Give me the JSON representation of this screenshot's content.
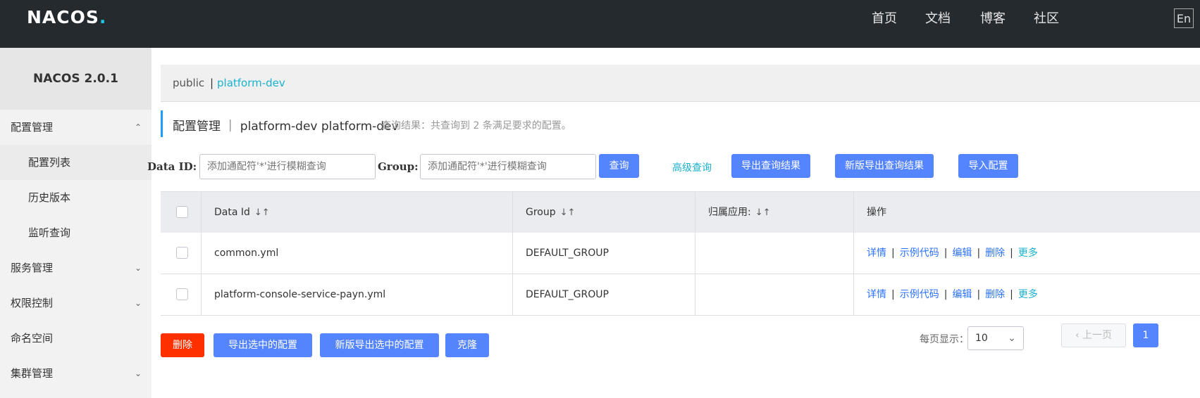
{
  "header": {
    "logo": "NACOS",
    "logo_dot": ".",
    "nav": [
      "首页",
      "文档",
      "博客",
      "社区"
    ],
    "lang": "En"
  },
  "sidebar": {
    "version": "NACOS 2.0.1",
    "items": [
      {
        "label": "配置管理",
        "expanded": true
      },
      {
        "label": "配置列表"
      },
      {
        "label": "历史版本"
      },
      {
        "label": "监听查询"
      },
      {
        "label": "服务管理"
      },
      {
        "label": "权限控制"
      },
      {
        "label": "命名空间"
      },
      {
        "label": "集群管理"
      }
    ]
  },
  "namespace_bar": {
    "items": [
      "public",
      "|",
      "platform-dev"
    ]
  },
  "title": {
    "text": "配置管理 ｜ platform-dev  platform-dev",
    "note": "查询结果：共查询到 2 条满足要求的配置。"
  },
  "search": {
    "data_id_label": "Data ID:",
    "data_id_placeholder": "添加通配符'*'进行模糊查询",
    "group_label": "Group:",
    "group_placeholder": "添加通配符'*'进行模糊查询",
    "query_button": "查询",
    "advanced_query": "高级查询",
    "export_button": "导出查询结果",
    "new_export_button": "新版导出查询结果",
    "import_button": "导入配置"
  },
  "table": {
    "headers": [
      "Data Id",
      "Group",
      "归属应用:",
      "操作"
    ],
    "rows": [
      {
        "data_id": "common.yml",
        "group": "DEFAULT_GROUP",
        "app": ""
      },
      {
        "data_id": "platform-console-service-payn.yml",
        "group": "DEFAULT_GROUP",
        "app": ""
      }
    ],
    "ops": [
      "详情",
      "示例代码",
      "编辑",
      "删除",
      "更多"
    ]
  },
  "footer": {
    "delete_button": "删除",
    "export_selected_button": "导出选中的配置",
    "new_export_selected_button": "新版导出选中的配置",
    "clone_button": "克隆",
    "page_size_label": "每页显示：",
    "page_size": "10",
    "prev": "上一页",
    "current_page": "1"
  },
  "colors": {
    "topbar": "#252a2f",
    "primary": "#5584ff",
    "danger": "#ff3000",
    "link": "#2b72ff",
    "accent": "#1ab1cf"
  }
}
